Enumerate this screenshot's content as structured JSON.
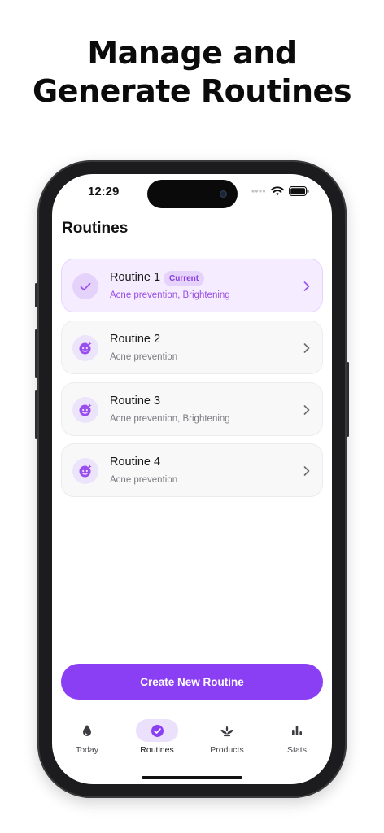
{
  "headline": {
    "line1": "Manage and",
    "line2": "Generate Routines"
  },
  "status_bar": {
    "time": "12:29"
  },
  "page_title": "Routines",
  "routines": [
    {
      "name": "Routine 1",
      "badge": "Current",
      "subtitle": "Acne prevention, Brightening",
      "icon": "checkmark-icon",
      "current": true
    },
    {
      "name": "Routine 2",
      "subtitle": "Acne prevention",
      "icon": "face-sparkle-icon",
      "current": false
    },
    {
      "name": "Routine 3",
      "subtitle": "Acne prevention, Brightening",
      "icon": "face-sparkle-icon",
      "current": false
    },
    {
      "name": "Routine 4",
      "subtitle": "Acne prevention",
      "icon": "face-sparkle-icon",
      "current": false
    }
  ],
  "create_button_label": "Create New Routine",
  "tabs": [
    {
      "label": "Today",
      "icon": "drop-icon",
      "active": false
    },
    {
      "label": "Routines",
      "icon": "check-circle-icon",
      "active": true
    },
    {
      "label": "Products",
      "icon": "lotus-icon",
      "active": false
    },
    {
      "label": "Stats",
      "icon": "bar-chart-icon",
      "active": false
    }
  ],
  "colors": {
    "accent": "#8b3ff5",
    "accent_soft": "#f5edff",
    "badge_text": "#8a3fe0",
    "card_background": "#f8f8f9"
  }
}
